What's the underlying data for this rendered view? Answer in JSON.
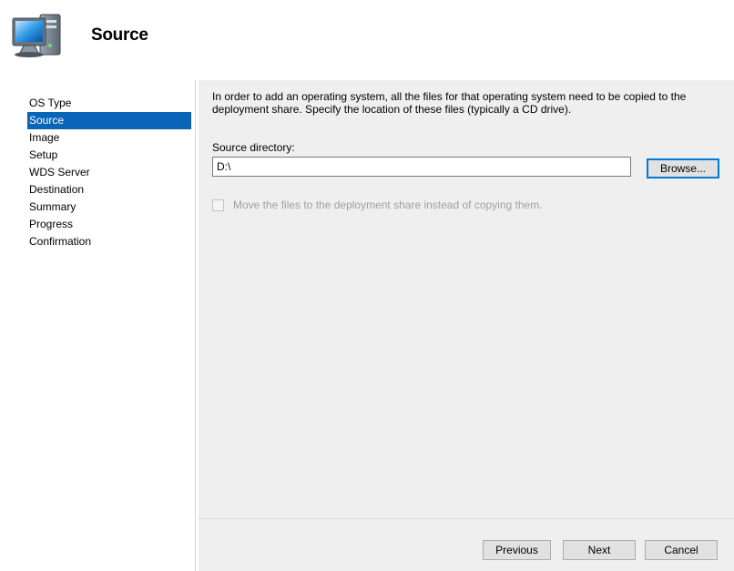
{
  "header": {
    "title": "Source",
    "icon": "computer-icon"
  },
  "sidebar": {
    "items": [
      {
        "label": "OS Type",
        "selected": false
      },
      {
        "label": "Source",
        "selected": true
      },
      {
        "label": "Image",
        "selected": false
      },
      {
        "label": "Setup",
        "selected": false
      },
      {
        "label": "WDS Server",
        "selected": false
      },
      {
        "label": "Destination",
        "selected": false
      },
      {
        "label": "Summary",
        "selected": false
      },
      {
        "label": "Progress",
        "selected": false
      },
      {
        "label": "Confirmation",
        "selected": false
      }
    ],
    "selected_color": "#0a64b8"
  },
  "main": {
    "intro": "In order to add an operating system, all the files for that operating system need to be copied to the deployment share.  Specify the location of these files (typically a CD drive).",
    "source_label": "Source directory:",
    "source_value": "D:\\",
    "browse_label": "Browse...",
    "move_label": "Move the files to the deployment share instead of copying them.",
    "move_checked": false,
    "move_enabled": false
  },
  "footer": {
    "previous_label": "Previous",
    "next_label": "Next",
    "cancel_label": "Cancel"
  }
}
